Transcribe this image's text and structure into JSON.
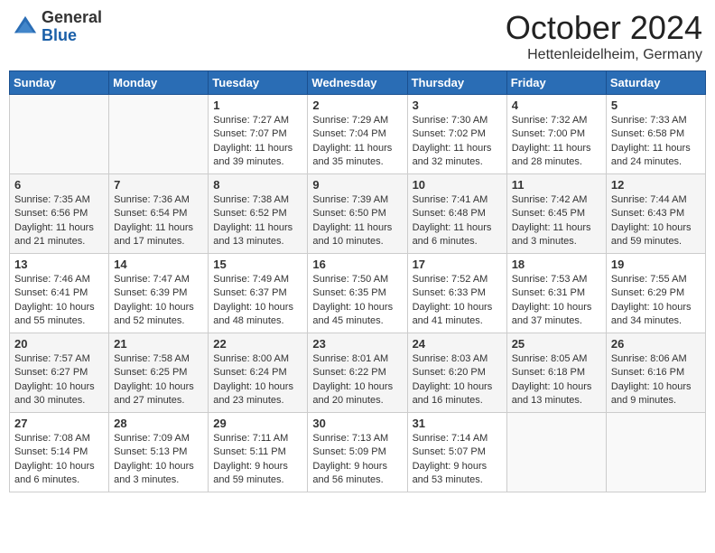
{
  "header": {
    "logo_line1": "General",
    "logo_line2": "Blue",
    "month": "October 2024",
    "location": "Hettenleidelheim, Germany"
  },
  "weekdays": [
    "Sunday",
    "Monday",
    "Tuesday",
    "Wednesday",
    "Thursday",
    "Friday",
    "Saturday"
  ],
  "weeks": [
    [
      {
        "day": "",
        "sunrise": "",
        "sunset": "",
        "daylight": "",
        "empty": true
      },
      {
        "day": "",
        "sunrise": "",
        "sunset": "",
        "daylight": "",
        "empty": true
      },
      {
        "day": "1",
        "sunrise": "Sunrise: 7:27 AM",
        "sunset": "Sunset: 7:07 PM",
        "daylight": "Daylight: 11 hours and 39 minutes."
      },
      {
        "day": "2",
        "sunrise": "Sunrise: 7:29 AM",
        "sunset": "Sunset: 7:04 PM",
        "daylight": "Daylight: 11 hours and 35 minutes."
      },
      {
        "day": "3",
        "sunrise": "Sunrise: 7:30 AM",
        "sunset": "Sunset: 7:02 PM",
        "daylight": "Daylight: 11 hours and 32 minutes."
      },
      {
        "day": "4",
        "sunrise": "Sunrise: 7:32 AM",
        "sunset": "Sunset: 7:00 PM",
        "daylight": "Daylight: 11 hours and 28 minutes."
      },
      {
        "day": "5",
        "sunrise": "Sunrise: 7:33 AM",
        "sunset": "Sunset: 6:58 PM",
        "daylight": "Daylight: 11 hours and 24 minutes."
      }
    ],
    [
      {
        "day": "6",
        "sunrise": "Sunrise: 7:35 AM",
        "sunset": "Sunset: 6:56 PM",
        "daylight": "Daylight: 11 hours and 21 minutes."
      },
      {
        "day": "7",
        "sunrise": "Sunrise: 7:36 AM",
        "sunset": "Sunset: 6:54 PM",
        "daylight": "Daylight: 11 hours and 17 minutes."
      },
      {
        "day": "8",
        "sunrise": "Sunrise: 7:38 AM",
        "sunset": "Sunset: 6:52 PM",
        "daylight": "Daylight: 11 hours and 13 minutes."
      },
      {
        "day": "9",
        "sunrise": "Sunrise: 7:39 AM",
        "sunset": "Sunset: 6:50 PM",
        "daylight": "Daylight: 11 hours and 10 minutes."
      },
      {
        "day": "10",
        "sunrise": "Sunrise: 7:41 AM",
        "sunset": "Sunset: 6:48 PM",
        "daylight": "Daylight: 11 hours and 6 minutes."
      },
      {
        "day": "11",
        "sunrise": "Sunrise: 7:42 AM",
        "sunset": "Sunset: 6:45 PM",
        "daylight": "Daylight: 11 hours and 3 minutes."
      },
      {
        "day": "12",
        "sunrise": "Sunrise: 7:44 AM",
        "sunset": "Sunset: 6:43 PM",
        "daylight": "Daylight: 10 hours and 59 minutes."
      }
    ],
    [
      {
        "day": "13",
        "sunrise": "Sunrise: 7:46 AM",
        "sunset": "Sunset: 6:41 PM",
        "daylight": "Daylight: 10 hours and 55 minutes."
      },
      {
        "day": "14",
        "sunrise": "Sunrise: 7:47 AM",
        "sunset": "Sunset: 6:39 PM",
        "daylight": "Daylight: 10 hours and 52 minutes."
      },
      {
        "day": "15",
        "sunrise": "Sunrise: 7:49 AM",
        "sunset": "Sunset: 6:37 PM",
        "daylight": "Daylight: 10 hours and 48 minutes."
      },
      {
        "day": "16",
        "sunrise": "Sunrise: 7:50 AM",
        "sunset": "Sunset: 6:35 PM",
        "daylight": "Daylight: 10 hours and 45 minutes."
      },
      {
        "day": "17",
        "sunrise": "Sunrise: 7:52 AM",
        "sunset": "Sunset: 6:33 PM",
        "daylight": "Daylight: 10 hours and 41 minutes."
      },
      {
        "day": "18",
        "sunrise": "Sunrise: 7:53 AM",
        "sunset": "Sunset: 6:31 PM",
        "daylight": "Daylight: 10 hours and 37 minutes."
      },
      {
        "day": "19",
        "sunrise": "Sunrise: 7:55 AM",
        "sunset": "Sunset: 6:29 PM",
        "daylight": "Daylight: 10 hours and 34 minutes."
      }
    ],
    [
      {
        "day": "20",
        "sunrise": "Sunrise: 7:57 AM",
        "sunset": "Sunset: 6:27 PM",
        "daylight": "Daylight: 10 hours and 30 minutes."
      },
      {
        "day": "21",
        "sunrise": "Sunrise: 7:58 AM",
        "sunset": "Sunset: 6:25 PM",
        "daylight": "Daylight: 10 hours and 27 minutes."
      },
      {
        "day": "22",
        "sunrise": "Sunrise: 8:00 AM",
        "sunset": "Sunset: 6:24 PM",
        "daylight": "Daylight: 10 hours and 23 minutes."
      },
      {
        "day": "23",
        "sunrise": "Sunrise: 8:01 AM",
        "sunset": "Sunset: 6:22 PM",
        "daylight": "Daylight: 10 hours and 20 minutes."
      },
      {
        "day": "24",
        "sunrise": "Sunrise: 8:03 AM",
        "sunset": "Sunset: 6:20 PM",
        "daylight": "Daylight: 10 hours and 16 minutes."
      },
      {
        "day": "25",
        "sunrise": "Sunrise: 8:05 AM",
        "sunset": "Sunset: 6:18 PM",
        "daylight": "Daylight: 10 hours and 13 minutes."
      },
      {
        "day": "26",
        "sunrise": "Sunrise: 8:06 AM",
        "sunset": "Sunset: 6:16 PM",
        "daylight": "Daylight: 10 hours and 9 minutes."
      }
    ],
    [
      {
        "day": "27",
        "sunrise": "Sunrise: 7:08 AM",
        "sunset": "Sunset: 5:14 PM",
        "daylight": "Daylight: 10 hours and 6 minutes."
      },
      {
        "day": "28",
        "sunrise": "Sunrise: 7:09 AM",
        "sunset": "Sunset: 5:13 PM",
        "daylight": "Daylight: 10 hours and 3 minutes."
      },
      {
        "day": "29",
        "sunrise": "Sunrise: 7:11 AM",
        "sunset": "Sunset: 5:11 PM",
        "daylight": "Daylight: 9 hours and 59 minutes."
      },
      {
        "day": "30",
        "sunrise": "Sunrise: 7:13 AM",
        "sunset": "Sunset: 5:09 PM",
        "daylight": "Daylight: 9 hours and 56 minutes."
      },
      {
        "day": "31",
        "sunrise": "Sunrise: 7:14 AM",
        "sunset": "Sunset: 5:07 PM",
        "daylight": "Daylight: 9 hours and 53 minutes."
      },
      {
        "day": "",
        "sunrise": "",
        "sunset": "",
        "daylight": "",
        "empty": true
      },
      {
        "day": "",
        "sunrise": "",
        "sunset": "",
        "daylight": "",
        "empty": true
      }
    ]
  ]
}
